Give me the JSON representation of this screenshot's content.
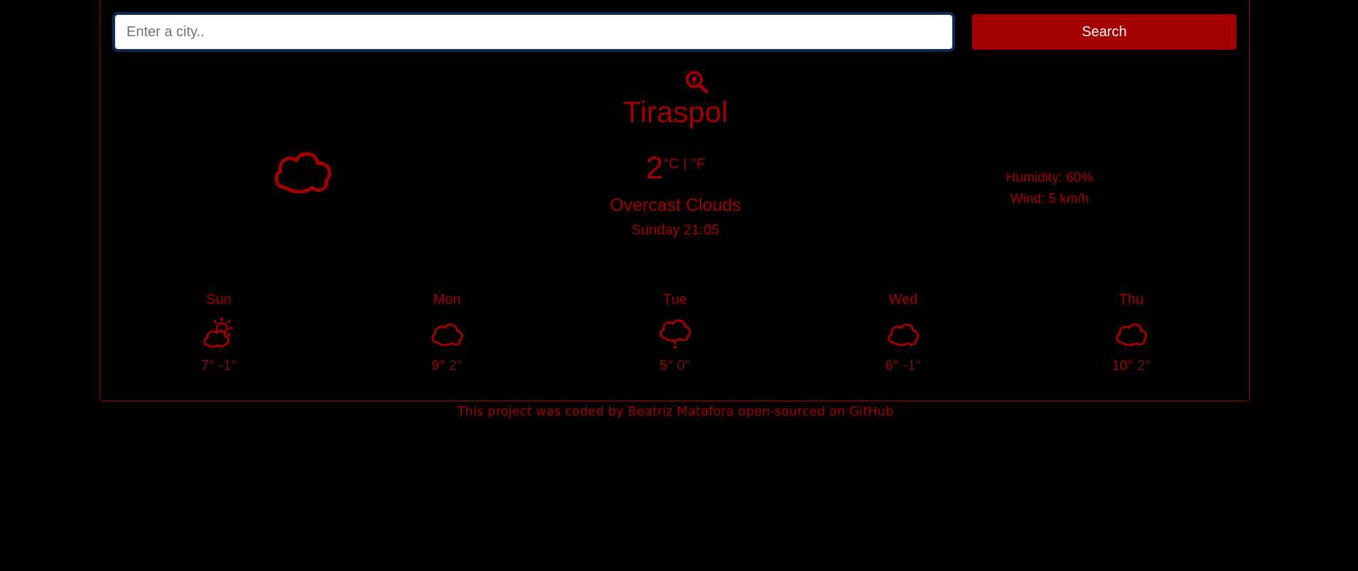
{
  "search": {
    "placeholder": "Enter a city..",
    "button_label": "Search"
  },
  "current": {
    "city": "Tiraspol",
    "temperature": "2",
    "unit_celsius": "°C",
    "unit_separator": " | ",
    "unit_fahrenheit": "°F",
    "description": "Overcast Clouds",
    "datetime": "Sunday 21:05",
    "humidity": "Humidity: 60%",
    "wind": "Wind: 5 km/h",
    "icon": "cloud-icon"
  },
  "forecast": [
    {
      "day": "Sun",
      "max": "7°",
      "min": "-1°",
      "icon": "partly-cloudy-icon"
    },
    {
      "day": "Mon",
      "max": "9°",
      "min": "2°",
      "icon": "cloud-icon"
    },
    {
      "day": "Tue",
      "max": "5°",
      "min": "0°",
      "icon": "rain-cloud-icon"
    },
    {
      "day": "Wed",
      "max": "6°",
      "min": "-1°",
      "icon": "cloud-icon"
    },
    {
      "day": "Thu",
      "max": "10°",
      "min": "2°",
      "icon": "cloud-icon"
    }
  ],
  "footer": {
    "prefix": "This project was coded by ",
    "author": "Beatriz Matafora",
    "middle": " open-sourced on ",
    "repo": "GitHub"
  },
  "colors": {
    "accent": "#a30000",
    "background": "#000000",
    "min_temp": "#6e1414"
  }
}
